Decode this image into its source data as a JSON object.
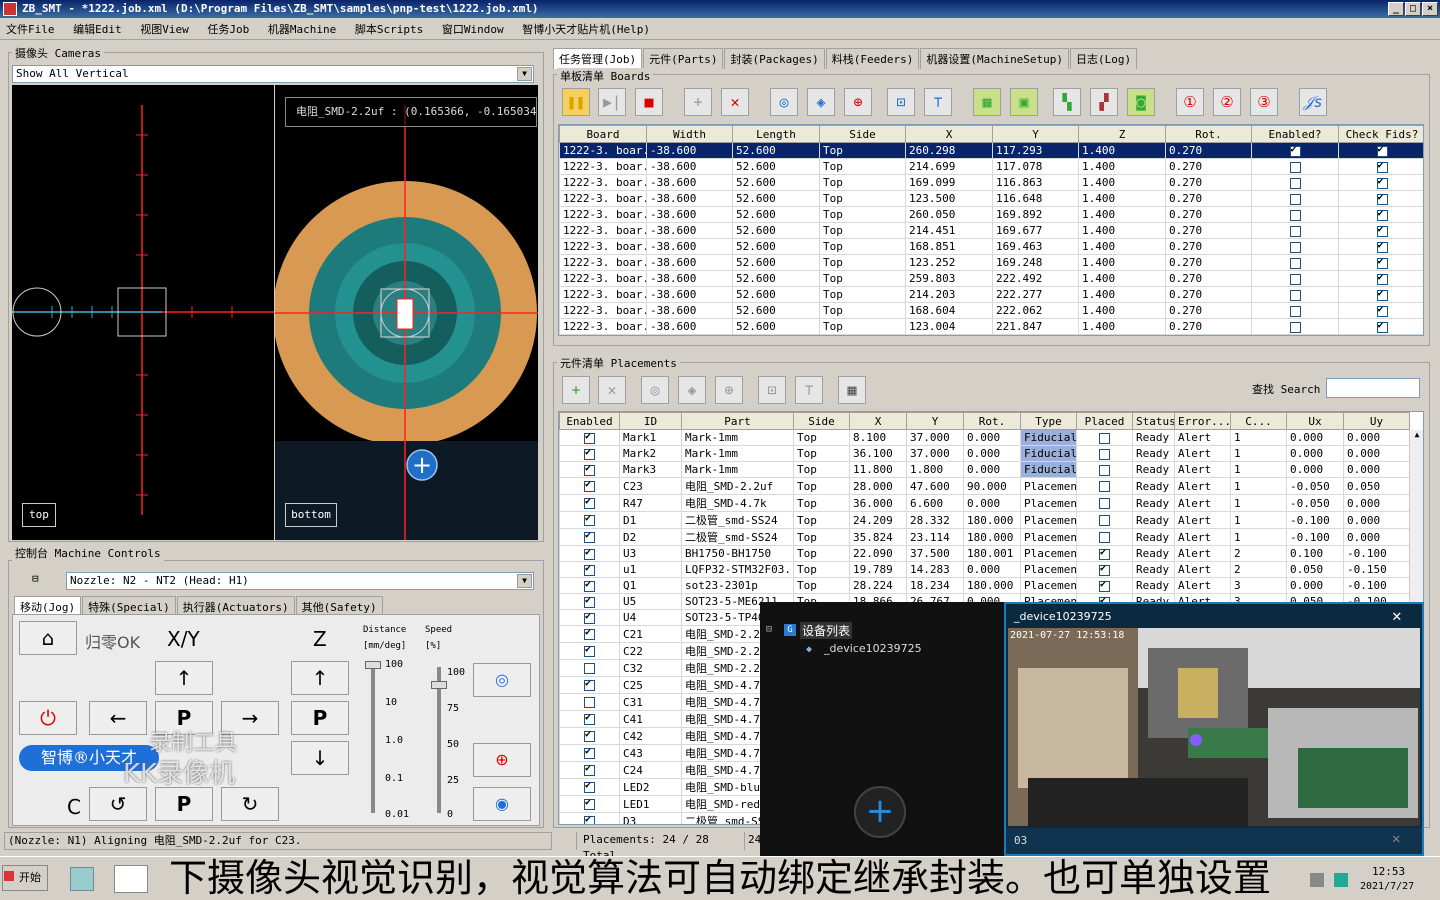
{
  "window": {
    "title": "ZB_SMT - *1222.job.xml  (D:\\Program Files\\ZB_SMT\\samples\\pnp-test\\1222.job.xml)"
  },
  "menu": [
    "文件File",
    "编辑Edit",
    "视图View",
    "任务Job",
    "机器Machine",
    "脚本Scripts",
    "窗口Window",
    "智博小天才贴片机(Help)"
  ],
  "cameras": {
    "label": "摄像头 Cameras",
    "view_select": "Show All Vertical",
    "top_label": "top",
    "bottom_label": "bottom",
    "overlay": "电阻_SMD-2.2uf :  (0.165366, -0.165034, 0."
  },
  "tabs": [
    "任务管理(Job)",
    "元件(Parts)",
    "封装(Packages)",
    "料栈(Feeders)",
    "机器设置(MachineSetup)",
    "日志(Log)"
  ],
  "boards": {
    "label": "单板清单 Boards",
    "columns": [
      "Board",
      "Width",
      "Length",
      "Side",
      "X",
      "Y",
      "Z",
      "Rot.",
      "Enabled?",
      "Check Fids?"
    ],
    "rows": [
      [
        "1222-3. boar...",
        "-38.600",
        "52.600",
        "Top",
        "260.298",
        "117.293",
        "1.400",
        "0.270",
        true,
        true
      ],
      [
        "1222-3. boar...",
        "-38.600",
        "52.600",
        "Top",
        "214.699",
        "117.078",
        "1.400",
        "0.270",
        false,
        true
      ],
      [
        "1222-3. boar...",
        "-38.600",
        "52.600",
        "Top",
        "169.099",
        "116.863",
        "1.400",
        "0.270",
        false,
        true
      ],
      [
        "1222-3. boar...",
        "-38.600",
        "52.600",
        "Top",
        "123.500",
        "116.648",
        "1.400",
        "0.270",
        false,
        true
      ],
      [
        "1222-3. boar...",
        "-38.600",
        "52.600",
        "Top",
        "260.050",
        "169.892",
        "1.400",
        "0.270",
        false,
        true
      ],
      [
        "1222-3. boar...",
        "-38.600",
        "52.600",
        "Top",
        "214.451",
        "169.677",
        "1.400",
        "0.270",
        false,
        true
      ],
      [
        "1222-3. boar...",
        "-38.600",
        "52.600",
        "Top",
        "168.851",
        "169.463",
        "1.400",
        "0.270",
        false,
        true
      ],
      [
        "1222-3. boar...",
        "-38.600",
        "52.600",
        "Top",
        "123.252",
        "169.248",
        "1.400",
        "0.270",
        false,
        true
      ],
      [
        "1222-3. boar...",
        "-38.600",
        "52.600",
        "Top",
        "259.803",
        "222.492",
        "1.400",
        "0.270",
        false,
        true
      ],
      [
        "1222-3. boar...",
        "-38.600",
        "52.600",
        "Top",
        "214.203",
        "222.277",
        "1.400",
        "0.270",
        false,
        true
      ],
      [
        "1222-3. boar...",
        "-38.600",
        "52.600",
        "Top",
        "168.604",
        "222.062",
        "1.400",
        "0.270",
        false,
        true
      ],
      [
        "1222-3. boar...",
        "-38.600",
        "52.600",
        "Top",
        "123.004",
        "221.847",
        "1.400",
        "0.270",
        false,
        true
      ]
    ]
  },
  "placements": {
    "label": "元件清单 Placements",
    "search_label": "查找 Search",
    "columns": [
      "Enabled",
      "ID",
      "Part",
      "Side",
      "X",
      "Y",
      "Rot.",
      "Type",
      "Placed",
      "Status",
      "Error...",
      "C...",
      "Ux",
      "Uy"
    ],
    "rows": [
      [
        true,
        "Mark1",
        "Mark-1mm",
        "Top",
        "8.100",
        "37.000",
        "0.000",
        "Fiducial",
        false,
        "Ready",
        "Alert",
        "1",
        "0.000",
        "0.000"
      ],
      [
        true,
        "Mark2",
        "Mark-1mm",
        "Top",
        "36.100",
        "37.000",
        "0.000",
        "Fiducial",
        false,
        "Ready",
        "Alert",
        "1",
        "0.000",
        "0.000"
      ],
      [
        true,
        "Mark3",
        "Mark-1mm",
        "Top",
        "11.800",
        "1.800",
        "0.000",
        "Fiducial",
        false,
        "Ready",
        "Alert",
        "1",
        "0.000",
        "0.000"
      ],
      [
        true,
        "C23",
        "电阻_SMD-2.2uf",
        "Top",
        "28.000",
        "47.600",
        "90.000",
        "Placement",
        false,
        "Ready",
        "Alert",
        "1",
        "-0.050",
        "0.050"
      ],
      [
        true,
        "R47",
        "电阻_SMD-4.7k",
        "Top",
        "36.000",
        "6.600",
        "0.000",
        "Placement",
        false,
        "Ready",
        "Alert",
        "1",
        "-0.050",
        "0.000"
      ],
      [
        true,
        "D1",
        "二极管_smd-SS24",
        "Top",
        "24.209",
        "28.332",
        "180.000",
        "Placement",
        false,
        "Ready",
        "Alert",
        "1",
        "-0.100",
        "0.000"
      ],
      [
        true,
        "D2",
        "二极管_smd-SS24",
        "Top",
        "35.824",
        "23.114",
        "180.000",
        "Placement",
        false,
        "Ready",
        "Alert",
        "1",
        "-0.100",
        "0.000"
      ],
      [
        true,
        "U3",
        "BH1750-BH1750",
        "Top",
        "22.090",
        "37.500",
        "180.001",
        "Placement",
        true,
        "Ready",
        "Alert",
        "2",
        "0.100",
        "-0.100"
      ],
      [
        true,
        "u1",
        "LQFP32-STM32F03...",
        "Top",
        "19.789",
        "14.283",
        "0.000",
        "Placement",
        true,
        "Ready",
        "Alert",
        "2",
        "0.050",
        "-0.150"
      ],
      [
        true,
        "Q1",
        "sot23-2301p",
        "Top",
        "28.224",
        "18.234",
        "180.000",
        "Placement",
        true,
        "Ready",
        "Alert",
        "3",
        "0.000",
        "-0.100"
      ],
      [
        true,
        "U5",
        "SOT23-5-ME6211",
        "Top",
        "18.866",
        "26.767",
        "0.000",
        "Placement",
        true,
        "Ready",
        "Alert",
        "3",
        "0.050",
        "-0.100"
      ],
      [
        true,
        "U4",
        "SOT23-5-TP405",
        "",
        "",
        "",
        "",
        "",
        false,
        "",
        "",
        "",
        "",
        ""
      ],
      [
        true,
        "C21",
        "电阻_SMD-2.2u",
        "",
        "",
        "",
        "",
        "",
        false,
        "",
        "",
        "",
        "",
        ""
      ],
      [
        true,
        "C22",
        "电阻_SMD-2.2u",
        "",
        "",
        "",
        "",
        "",
        false,
        "",
        "",
        "",
        "",
        ""
      ],
      [
        false,
        "C32",
        "电阻_SMD-2.2u",
        "",
        "",
        "",
        "",
        "",
        false,
        "",
        "",
        "",
        "",
        ""
      ],
      [
        true,
        "C25",
        "电阻_SMD-4.7u",
        "",
        "",
        "",
        "",
        "",
        false,
        "",
        "",
        "",
        "",
        ""
      ],
      [
        false,
        "C31",
        "电阻_SMD-4.7u",
        "",
        "",
        "",
        "",
        "",
        false,
        "",
        "",
        "",
        "",
        ""
      ],
      [
        true,
        "C41",
        "电阻_SMD-4.7u",
        "",
        "",
        "",
        "",
        "",
        false,
        "",
        "",
        "",
        "",
        ""
      ],
      [
        true,
        "C42",
        "电阻_SMD-4.7u",
        "",
        "",
        "",
        "",
        "",
        false,
        "",
        "",
        "",
        "",
        ""
      ],
      [
        true,
        "C43",
        "电阻_SMD-4.7u",
        "",
        "",
        "",
        "",
        "",
        false,
        "",
        "",
        "",
        "",
        ""
      ],
      [
        true,
        "C24",
        "电阻_SMD-4.7u",
        "",
        "",
        "",
        "",
        "",
        false,
        "",
        "",
        "",
        "",
        ""
      ],
      [
        true,
        "LED2",
        "电阻_SMD-blue",
        "",
        "",
        "",
        "",
        "",
        false,
        "",
        "",
        "",
        "",
        ""
      ],
      [
        true,
        "LED1",
        "电阻_SMD-red",
        "",
        "",
        "",
        "",
        "",
        false,
        "",
        "",
        "",
        "",
        ""
      ],
      [
        true,
        "D3",
        "二极管_smd-SS",
        "",
        "",
        "",
        "",
        "",
        false,
        "",
        "",
        "",
        "",
        ""
      ]
    ]
  },
  "machine": {
    "label": "控制台 Machine Controls",
    "nozzle": "Nozzle: N2 - NT2 (Head: H1)",
    "tabs": [
      "移动(Jog)",
      "特殊(Special)",
      "执行器(Actuators)",
      "其他(Safety)"
    ],
    "home_label": "归零OK",
    "xy_label": "X/Y",
    "z_label": "Z",
    "c_label": "C",
    "distance_label": "Distance",
    "distance_unit": "[mm/deg]",
    "speed_label": "Speed",
    "speed_unit": "[%]",
    "distance_ticks": [
      "100",
      "10",
      "1.0",
      "0.1",
      "0.01"
    ],
    "speed_ticks": [
      "100",
      "75",
      "50",
      "25",
      "0"
    ],
    "brand": "智博®小天才"
  },
  "status": {
    "message": "(Nozzle: N1) Aligning 电阻_SMD-2.2uf for C23.",
    "placements": "Placements: 24 / 28 Total",
    "partial": "24"
  },
  "device_panel": {
    "tree_root": "设备列表",
    "tree_child": "_device10239725",
    "video_title": "_device10239725",
    "video_timestamp": "2021-07-27 12:53:18",
    "footer": "03"
  },
  "watermark": {
    "line1": "录制工具",
    "line2": "KK录像机"
  },
  "taskbar": {
    "start": "开始",
    "time": "12:53",
    "date": "2021/7/27"
  },
  "subtitle": "下摄像头视觉识别，视觉算法可自动绑定继承封装。也可单独设置",
  "colors": {
    "accent": "#0a246a",
    "fiducial": "#9ab0dc",
    "crosshair": "#ff2020",
    "camera_teal": "#1e7b7b",
    "camera_orange": "#d89a52"
  }
}
